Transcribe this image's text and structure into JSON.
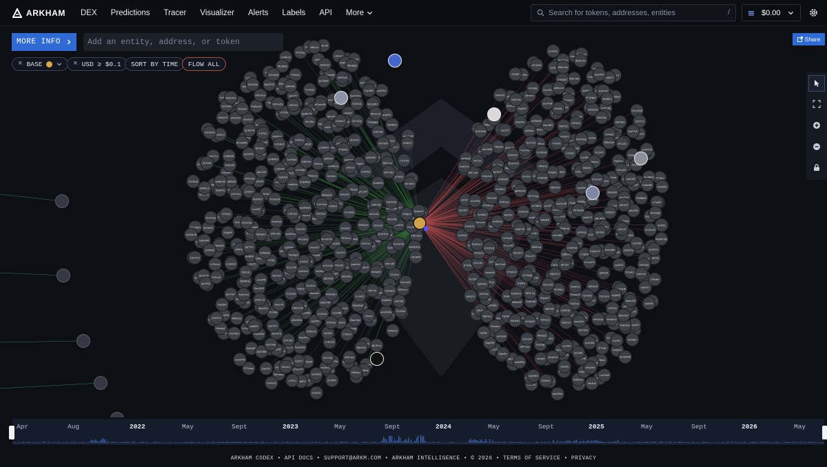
{
  "brand": {
    "name": "ARKHAM"
  },
  "nav": {
    "items": [
      "DEX",
      "Predictions",
      "Tracer",
      "Visualizer",
      "Alerts",
      "Labels",
      "API"
    ],
    "more_label": "More"
  },
  "search": {
    "placeholder": "Search for tokens, addresses, entities",
    "shortcut": "/"
  },
  "wallet": {
    "amount": "$0.00"
  },
  "toolbar": {
    "more_info_label": "MORE INFO",
    "entity_placeholder": "Add an entity, address, or token",
    "share_label": "Share"
  },
  "filters": {
    "chain": "BASE",
    "usd": "USD ≥ $0.1",
    "sort": "SORT BY TIME",
    "flow": "FLOW ALL"
  },
  "timeline": {
    "labels": [
      "Apr",
      "Aug",
      "2022",
      "May",
      "Sept",
      "2023",
      "May",
      "Sept",
      "2024",
      "May",
      "Sept",
      "2025",
      "May",
      "Sept",
      "2026",
      "May"
    ],
    "years": [
      "2022",
      "2023",
      "2024",
      "2025",
      "2026"
    ]
  },
  "footer": {
    "items": [
      "ARKHAM CODEX",
      "API DOCS",
      "SUPPORT@ARKM.COM",
      "ARKHAM INTELLIGENCE",
      "© 2026",
      "TERMS OF SERVICE",
      "PRIVACY"
    ]
  },
  "colors": {
    "inflow": "#3c8a3f",
    "outflow": "#b64a4a",
    "node": "#3c3f46",
    "accent": "#2f6ad6"
  }
}
